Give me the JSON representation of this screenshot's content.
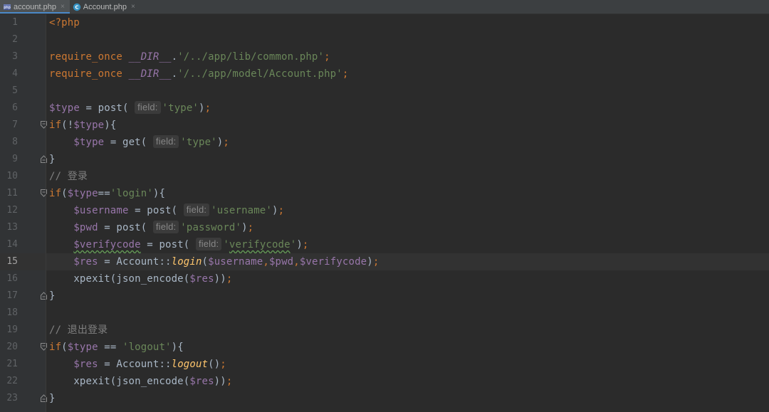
{
  "tabs": [
    {
      "label": "account.php",
      "active": true,
      "icon": "php-file-icon"
    },
    {
      "label": "Account.php",
      "active": false,
      "icon": "php-class-icon"
    }
  ],
  "close_glyph": "×",
  "hint_label": "field:",
  "current_line": 15,
  "lines": [
    {
      "n": "1"
    },
    {
      "n": "2"
    },
    {
      "n": "3"
    },
    {
      "n": "4"
    },
    {
      "n": "5"
    },
    {
      "n": "6"
    },
    {
      "n": "7"
    },
    {
      "n": "8"
    },
    {
      "n": "9"
    },
    {
      "n": "10"
    },
    {
      "n": "11"
    },
    {
      "n": "12"
    },
    {
      "n": "13"
    },
    {
      "n": "14"
    },
    {
      "n": "15"
    },
    {
      "n": "16"
    },
    {
      "n": "17"
    },
    {
      "n": "18"
    },
    {
      "n": "19"
    },
    {
      "n": "20"
    },
    {
      "n": "21"
    },
    {
      "n": "22"
    },
    {
      "n": "23"
    }
  ],
  "code": {
    "php_open": "<?php",
    "require_once": "require_once",
    "dir_const": "__DIR__",
    "dot": ".",
    "path_common": "'/../app/lib/common.php'",
    "path_model": "'/../app/model/Account.php'",
    "semicolon": ";",
    "var_type": "$type",
    "var_username": "$username",
    "var_pwd": "$pwd",
    "var_verifycode": "$verifycode",
    "var_res": "$res",
    "post": "post(",
    "get": "get(",
    "str_type": "'type'",
    "str_username": "'username'",
    "str_password": "'password'",
    "str_verifycode_q": "'",
    "str_verifycode": "verifycode",
    "str_login": "'login'",
    "str_logout": "'logout'",
    "if_open": "if",
    "comment_login": "// 登录",
    "comment_logout": "// 退出登录",
    "account_cls": "Account::",
    "login_fn": "login",
    "logout_fn": "logout",
    "xpexit": "xpexit(json_encode(",
    "brace_close": "}"
  }
}
